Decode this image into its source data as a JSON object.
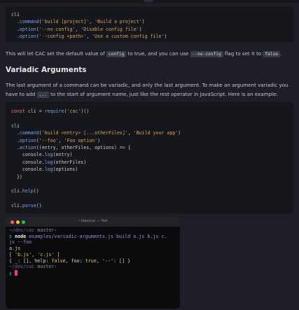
{
  "code1": {
    "l1": "cli",
    "l2": {
      "p": "  .",
      "fn": "command",
      "a": "(",
      "s1": "'build [project]'",
      "b": ", ",
      "s2": "'Build a project'",
      "c": ")"
    },
    "l3": {
      "p": "  .",
      "fn": "option",
      "a": "(",
      "s1": "'--no-config'",
      "b": ", ",
      "s2": "'Disable config file'",
      "c": ")"
    },
    "l4": {
      "p": "  .",
      "fn": "option",
      "a": "(",
      "s1": "'--config <path>'",
      "b": ", ",
      "s2": "'Use a custom config file'",
      "c": ")"
    }
  },
  "para1": {
    "t1": "This will let CAC set the default value of ",
    "c1": "config",
    "t2": " to true, and you can use ",
    "c2": "--no-config",
    "t3": " flag to set it to ",
    "c3": "false",
    "t4": "."
  },
  "heading": "Variadic Arguments",
  "para2": {
    "t1": "The last argument of a command can be variadic, and only the last argument. To make an argument variadic you have to add ",
    "c1": "...",
    "t2": " to the start of argument name, just like the rest operator in JavaScript. Here is an example:"
  },
  "code2": {
    "l1": {
      "kw": "const",
      "sp": " ",
      "v": "cli",
      "eq": " = ",
      "fn": "require",
      "a": "(",
      "s": "'cac'",
      "b": ")()"
    },
    "l2": "cli",
    "l3": {
      "p": "  .",
      "fn": "command",
      "a": "(",
      "s1": "'build <entry> [...otherFiles]'",
      "b": ", ",
      "s2": "'Build your app'",
      "c": ")"
    },
    "l4": {
      "p": "  .",
      "fn": "option",
      "a": "(",
      "s1": "'--foo'",
      "b": ", ",
      "s2": "'Foo option'",
      "c": ")"
    },
    "l5": {
      "p": "  .",
      "fn": "action",
      "a": "((entry, otherFiles, options) => {"
    },
    "l6": {
      "p": "    console.",
      "fn": "log",
      "a": "(entry)"
    },
    "l7": {
      "p": "    console.",
      "fn": "log",
      "a": "(otherFiles)"
    },
    "l8": {
      "p": "    console.",
      "fn": "log",
      "a": "(options)"
    },
    "l9": "  })",
    "l10": {
      "p": "cli.",
      "fn": "help",
      "a": "()"
    },
    "l11": {
      "p": "cli.",
      "fn": "parse",
      "a": "()"
    }
  },
  "terminal": {
    "title": "~/dev/cac — fish",
    "r1": {
      "dir": "~/dev/cac",
      "branch": " master›"
    },
    "r2": {
      "arrow": "❯ ",
      "cmd": "node",
      "arg": " examples/variadic-arguments.js",
      "rest": " build a.js b.js c."
    },
    "r3": "js --foo",
    "r4": "a.js",
    "r5": {
      "a": "[ ",
      "s1": "'b.js'",
      "b": ", ",
      "s2": "'c.js'",
      "c": " ]"
    },
    "r6": {
      "a": "{ _: [], help: ",
      "f1": "false",
      "b": ", foo: ",
      "t1": "true",
      "c": ", '--': [] }"
    },
    "r7": {
      "dir": "~/dev/cac",
      "branch": " master›"
    },
    "r8": {
      "arrow": "❯ "
    }
  },
  "colors": {
    "background": "#1e1f26",
    "code_background": "#16171d",
    "function": "#7aa7e8",
    "string": "#d9a25e",
    "keyword": "#e07a8c",
    "cursor": "#ff2e97"
  }
}
